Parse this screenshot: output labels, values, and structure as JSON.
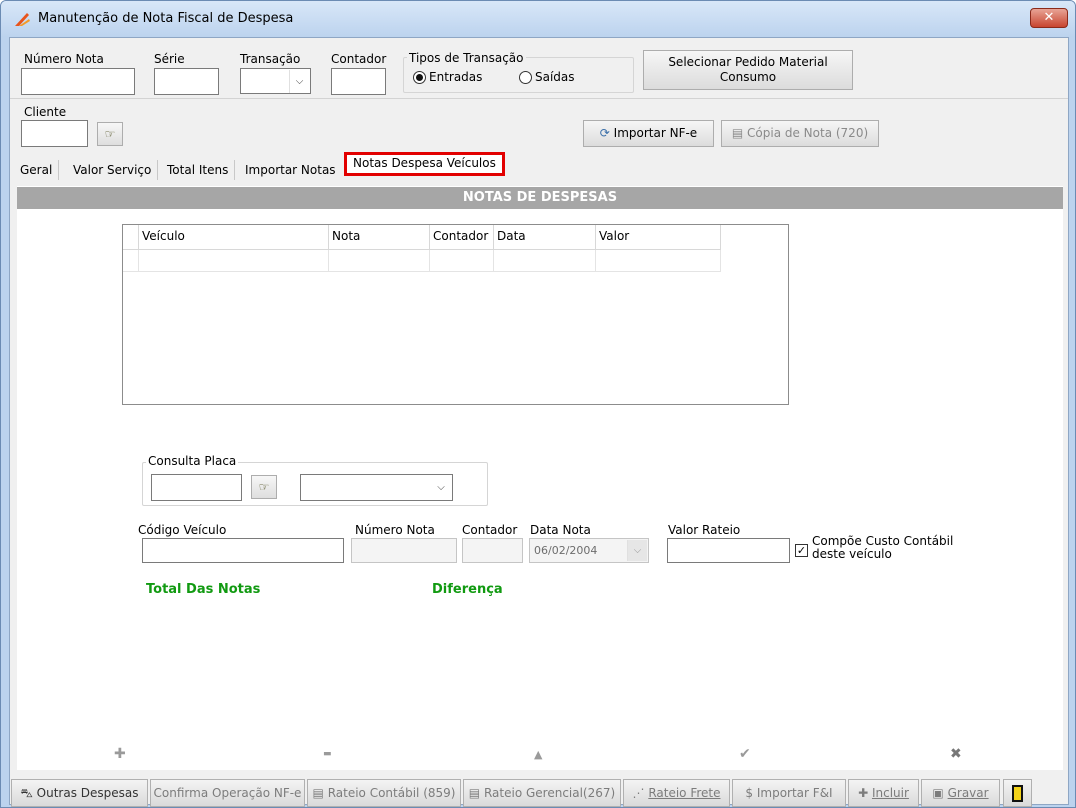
{
  "window": {
    "title": "Manutenção de Nota Fiscal de Despesa",
    "close_glyph": "✕",
    "icon": "app-logo-icon"
  },
  "header": {
    "numero_nota_label": "Número Nota",
    "serie_label": "Série",
    "transacao_label": "Transação",
    "contador_label": "Contador",
    "tipos_label": "Tipos de Transação",
    "entradas_label": "Entradas",
    "saidas_label": "Saídas",
    "selected_tipo": "Entradas",
    "selecionar_pedido_label": "Selecionar Pedido Material Consumo",
    "cliente_label": "Cliente",
    "importar_nfe_label": "Importar NF-e",
    "copia_nota_label": "Cópia de Nota (720)"
  },
  "tabs": [
    {
      "label": "Geral"
    },
    {
      "label": "Valor Serviço"
    },
    {
      "label": "Total Itens"
    },
    {
      "label": "Importar Notas"
    },
    {
      "label": "Notas Despesa Veículos",
      "active": true
    }
  ],
  "panel": {
    "banner": "NOTAS DE DESPESAS",
    "grid_columns": [
      "Veículo",
      "Nota",
      "Contador",
      "Data",
      "Valor"
    ],
    "consulta_placa_label": "Consulta Placa",
    "codigo_veiculo_label": "Código Veículo",
    "numero_nota_label": "Número Nota",
    "contador_label": "Contador",
    "data_nota_label": "Data Nota",
    "data_nota_value": "06/02/2004",
    "valor_rateio_label": "Valor Rateio",
    "compoe_label_line1": "Compõe Custo Contábil",
    "compoe_label_line2": "deste veículo",
    "compoe_checked": true,
    "total_das_notas_label": "Total Das Notas",
    "diferenca_label": "Diferença"
  },
  "nav_icons": [
    {
      "name": "add-icon",
      "glyph": "✚"
    },
    {
      "name": "remove-icon",
      "glyph": "▬"
    },
    {
      "name": "up-icon",
      "glyph": "▲"
    },
    {
      "name": "confirm-icon",
      "glyph": "✔"
    },
    {
      "name": "cancel-icon",
      "glyph": "✖"
    }
  ],
  "bottom_buttons": [
    {
      "label": "Outras Despesas",
      "icon": "car-icon"
    },
    {
      "label": "Confirma Operação NF-e"
    },
    {
      "label": "Rateio Contábil (859)",
      "icon": "document-icon"
    },
    {
      "label": "Rateio Gerencial(267)",
      "icon": "document-icon"
    },
    {
      "label": "Rateio Frete",
      "icon": "truck-icon"
    },
    {
      "label": "Importar F&I",
      "icon": "dollar-icon"
    },
    {
      "label": "Incluir",
      "icon": "plus-icon"
    },
    {
      "label": "Gravar",
      "icon": "save-icon"
    },
    {
      "label": "",
      "icon": "exit-door-icon"
    }
  ],
  "colors": {
    "active_tab_border": "#e20000",
    "green_label": "#119a11",
    "banner_bg": "#a6a6a6"
  }
}
